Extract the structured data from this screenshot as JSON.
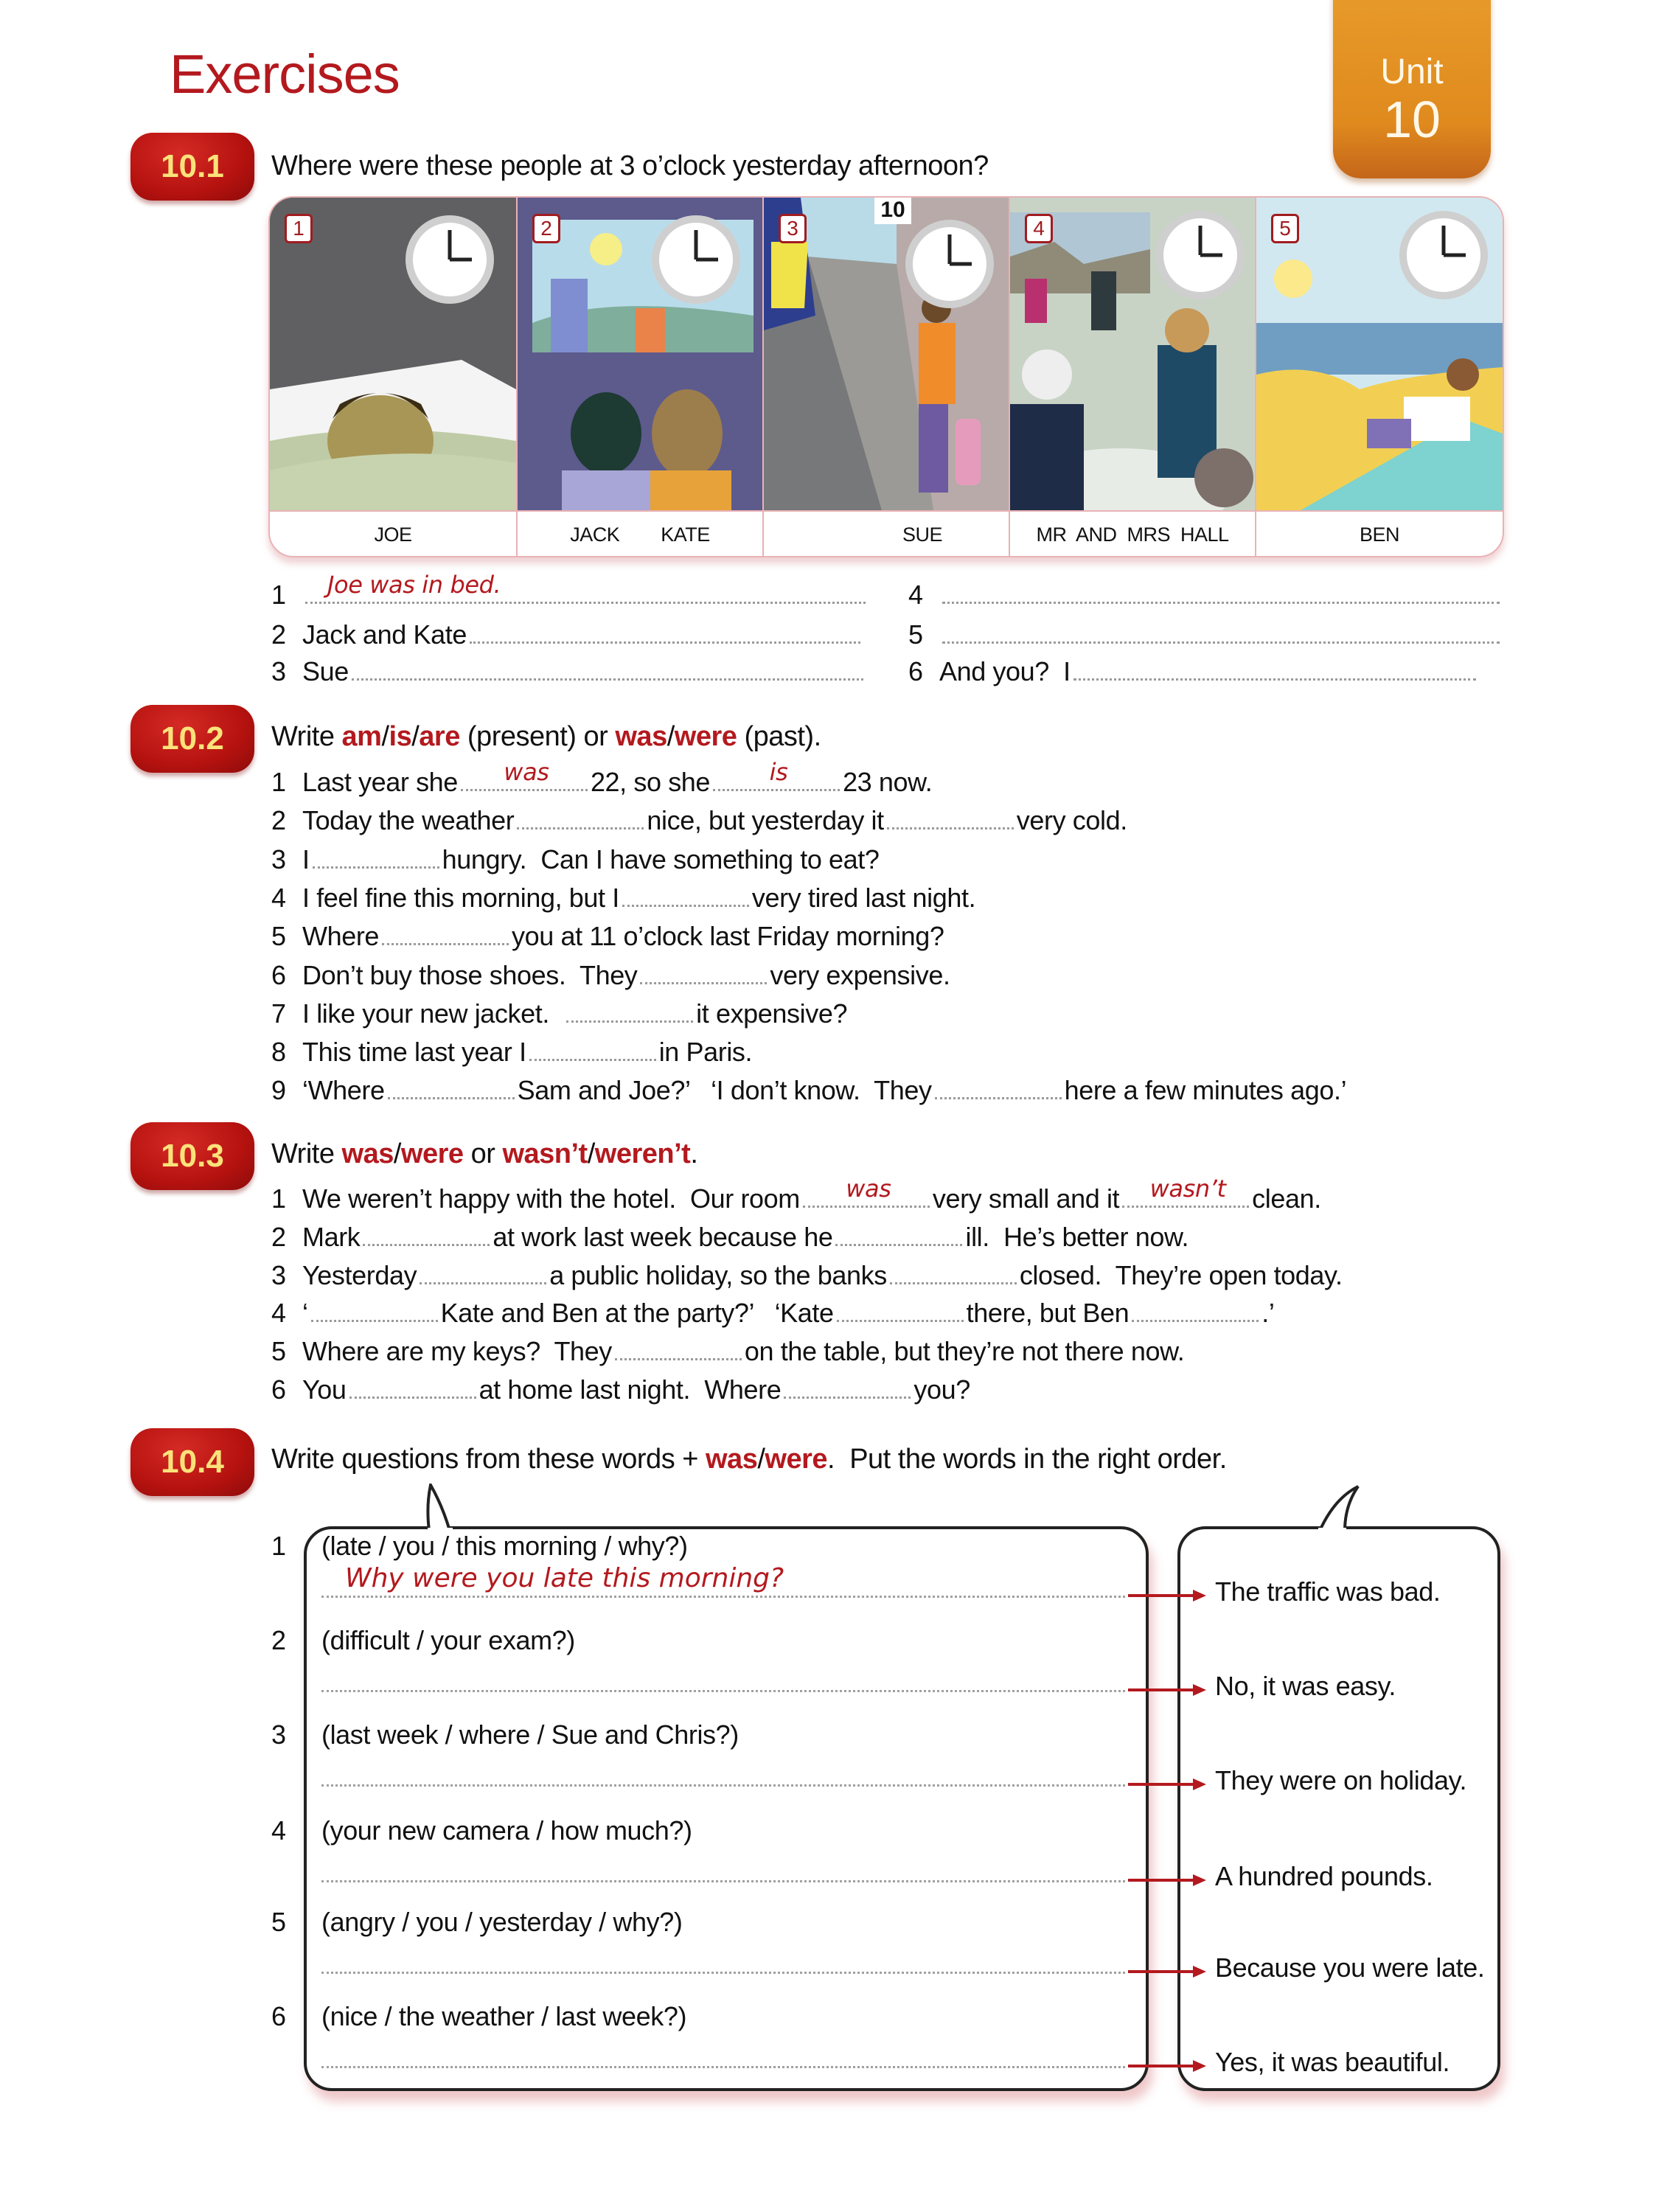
{
  "header": {
    "title": "Exercises",
    "unit_label": "Unit",
    "unit_number": "10"
  },
  "colors": {
    "accent_red": "#b3191e",
    "unit_orange": "#e08a1e",
    "badge_text": "#fbe27a"
  },
  "ex1": {
    "badge": "10.1",
    "instruction": "Where were these people at 3 o’clock yesterday afternoon?",
    "pictures": [
      {
        "num": "1",
        "scene": "bed",
        "names": "JOE"
      },
      {
        "num": "2",
        "scene": "cinema",
        "names": "JACK        KATE"
      },
      {
        "num": "3",
        "scene": "station",
        "names": "SUE",
        "sign": "10"
      },
      {
        "num": "4",
        "scene": "restaurant",
        "names": "MR  AND  MRS  HALL"
      },
      {
        "num": "5",
        "scene": "beach",
        "names": "BEN"
      }
    ],
    "items": [
      {
        "num": "1",
        "prefix": "",
        "answer": "Joe was in bed."
      },
      {
        "num": "2",
        "prefix": "Jack and Kate",
        "answer": ""
      },
      {
        "num": "3",
        "prefix": "Sue",
        "answer": ""
      },
      {
        "num": "4",
        "prefix": "",
        "answer": ""
      },
      {
        "num": "5",
        "prefix": "",
        "answer": ""
      },
      {
        "num": "6",
        "prefix": "And you?  I",
        "answer": ""
      }
    ]
  },
  "ex2": {
    "badge": "10.2",
    "instruction": {
      "w1": "Write ",
      "r1": "am",
      "s1": "/",
      "r2": "is",
      "s2": "/",
      "r3": "are",
      "w2": " (present) or ",
      "r4": "was",
      "s3": "/",
      "r5": "were",
      "w3": " (past)."
    },
    "items": [
      {
        "num": "1",
        "parts": [
          "Last year she",
          "22, so she",
          "23 now."
        ],
        "answers": [
          "was",
          "is"
        ]
      },
      {
        "num": "2",
        "parts": [
          "Today the weather",
          "nice, but yesterday it",
          "very cold."
        ],
        "answers": [
          "",
          ""
        ]
      },
      {
        "num": "3",
        "parts": [
          "I",
          "hungry.  Can I have something to eat?"
        ],
        "answers": [
          ""
        ]
      },
      {
        "num": "4",
        "parts": [
          "I feel fine this morning, but I",
          "very tired last night."
        ],
        "answers": [
          ""
        ]
      },
      {
        "num": "5",
        "parts": [
          "Where",
          "you at 11 o’clock last Friday morning?"
        ],
        "answers": [
          ""
        ]
      },
      {
        "num": "6",
        "parts": [
          "Don’t buy those shoes.  They",
          "very expensive."
        ],
        "answers": [
          ""
        ]
      },
      {
        "num": "7",
        "parts": [
          "I like your new jacket.  ",
          "it expensive?"
        ],
        "answers": [
          ""
        ]
      },
      {
        "num": "8",
        "parts": [
          "This time last year I",
          "in Paris."
        ],
        "answers": [
          ""
        ]
      },
      {
        "num": "9",
        "parts": [
          "‘Where",
          "Sam and Joe?’   ‘I don’t know.  They",
          "here a few minutes ago.’"
        ],
        "answers": [
          "",
          ""
        ]
      }
    ]
  },
  "ex3": {
    "badge": "10.3",
    "instruction": {
      "w1": "Write ",
      "r1": "was",
      "s1": "/",
      "r2": "were",
      "w2": " or ",
      "r3": "wasn’t",
      "s2": "/",
      "r4": "weren’t",
      "w3": "."
    },
    "items": [
      {
        "num": "1",
        "parts": [
          "We weren’t happy with the hotel.  Our room",
          "very small and it",
          "clean."
        ],
        "answers": [
          "was",
          "wasn’t"
        ]
      },
      {
        "num": "2",
        "parts": [
          "Mark",
          "at work last week because he",
          "ill.  He’s better now."
        ],
        "answers": [
          "",
          ""
        ]
      },
      {
        "num": "3",
        "parts": [
          "Yesterday",
          "a public holiday, so the banks",
          "closed.  They’re open today."
        ],
        "answers": [
          "",
          ""
        ]
      },
      {
        "num": "4",
        "parts": [
          "‘",
          "Kate and Ben at the party?’   ‘Kate",
          "there, but Ben",
          ".’"
        ],
        "answers": [
          "",
          "",
          ""
        ]
      },
      {
        "num": "5",
        "parts": [
          "Where are my keys?  They",
          "on the table, but they’re not there now."
        ],
        "answers": [
          ""
        ]
      },
      {
        "num": "6",
        "parts": [
          "You",
          "at home last night.  Where",
          "you?"
        ],
        "answers": [
          "",
          ""
        ]
      }
    ]
  },
  "ex4": {
    "badge": "10.4",
    "instruction": {
      "w1": "Write questions from these words + ",
      "r1": "was",
      "s1": "/",
      "r2": "were",
      "w2": ".  Put the words in the right order."
    },
    "items": [
      {
        "num": "1",
        "prompt": "(late / you / this morning / why?)",
        "answer": "Why were you late this morning?",
        "reply": "The traffic was bad."
      },
      {
        "num": "2",
        "prompt": "(difficult / your exam?)",
        "answer": "",
        "reply": "No, it was easy."
      },
      {
        "num": "3",
        "prompt": "(last week / where / Sue and Chris?)",
        "answer": "",
        "reply": "They were on holiday."
      },
      {
        "num": "4",
        "prompt": "(your new camera / how much?)",
        "answer": "",
        "reply": "A hundred pounds."
      },
      {
        "num": "5",
        "prompt": "(angry / you / yesterday / why?)",
        "answer": "",
        "reply": "Because you were late."
      },
      {
        "num": "6",
        "prompt": "(nice / the weather / last week?)",
        "answer": "",
        "reply": "Yes, it was beautiful."
      }
    ]
  }
}
